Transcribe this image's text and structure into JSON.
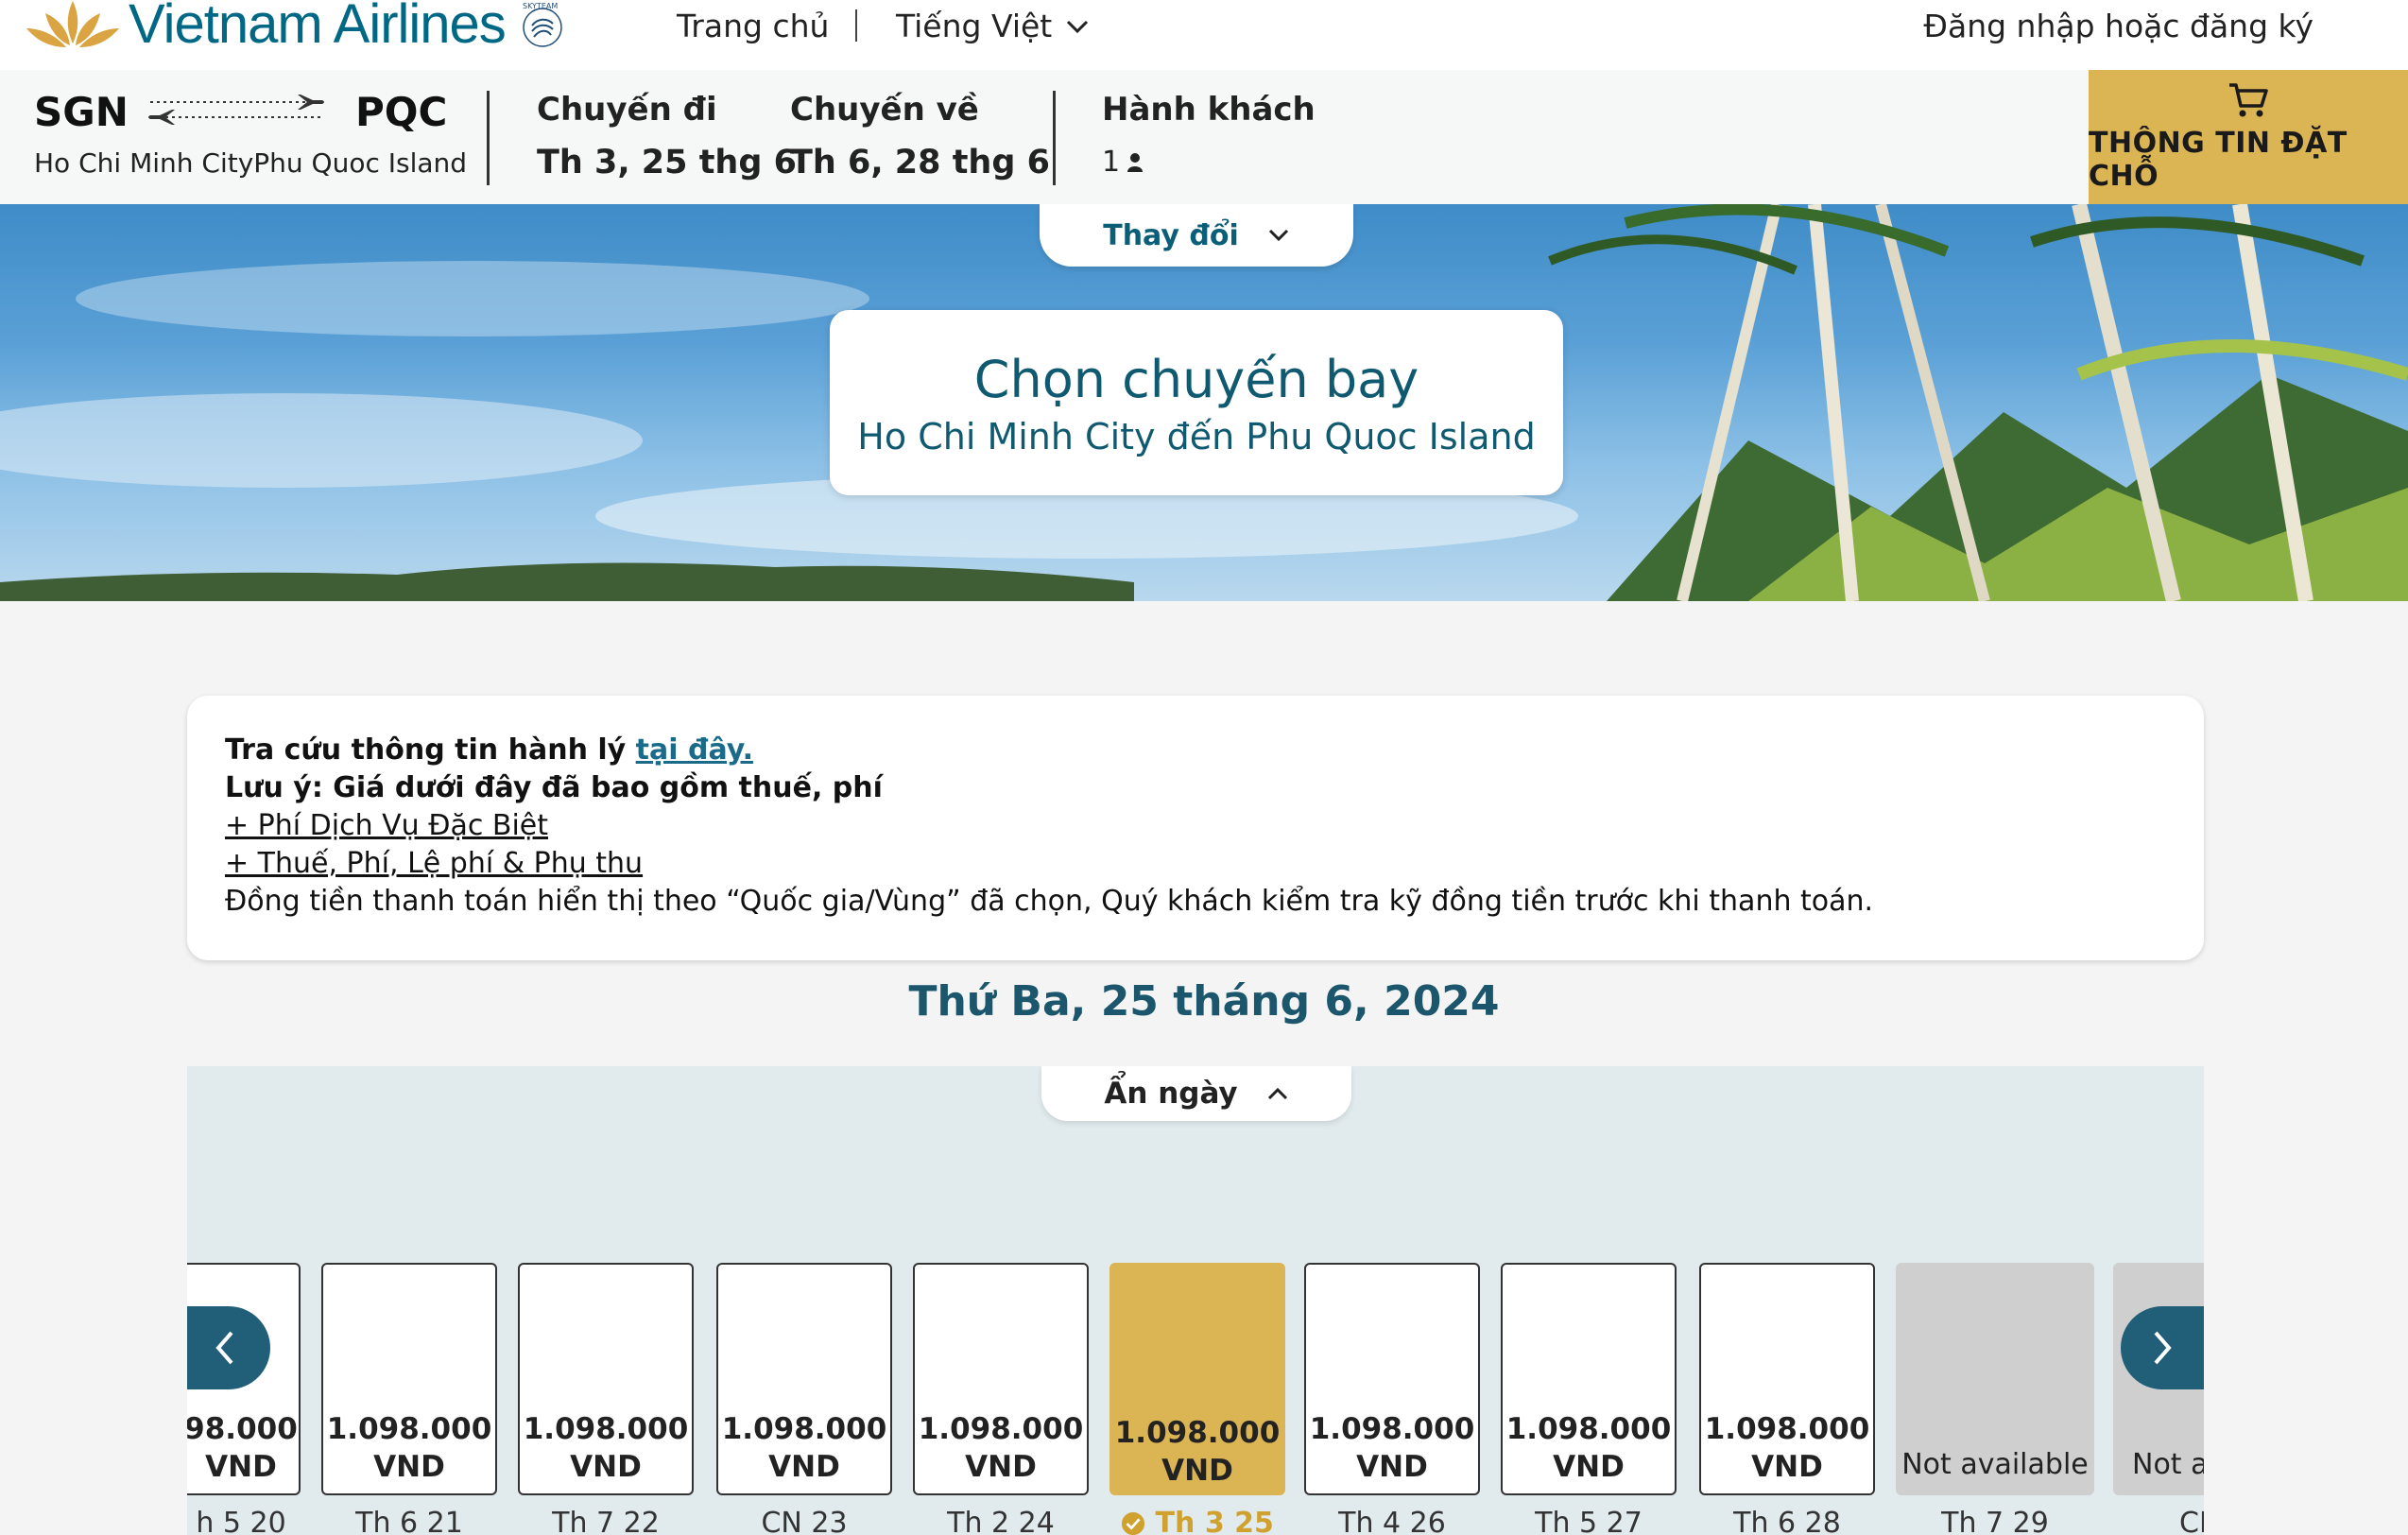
{
  "header": {
    "brand": "Vietnam Airlines",
    "nav_home": "Trang chủ",
    "nav_language": "Tiếng Việt",
    "login": "Đăng nhập hoặc đăng ký"
  },
  "itinerary": {
    "origin_code": "SGN",
    "destination_code": "PQC",
    "cities": "Ho Chi Minh CityPhu Quoc Island",
    "outbound_label": "Chuyến đi",
    "outbound_date": "Th 3, 25 thg 6",
    "return_label": "Chuyến về",
    "return_date": "Th 6, 28 thg 6",
    "passengers_label": "Hành khách",
    "passengers_count": "1",
    "booking_button": "THÔNG TIN ĐẶT CHỖ"
  },
  "hero": {
    "change_tab": "Thay đổi",
    "title": "Chọn chuyến bay",
    "subtitle": "Ho Chi Minh City đến Phu Quoc Island"
  },
  "info": {
    "baggage_text": "Tra cứu thông tin hành lý ",
    "baggage_link": "tại đây.",
    "note": "Lưu ý: Giá dưới đây đã bao gồm thuế, phí",
    "special_fees_link": "+ Phí Dịch Vụ Đặc Biệt",
    "taxes_link": "+ Thuế, Phí, Lệ phí & Phụ thu",
    "currency_note": "Đồng tiền thanh toán hiển thị theo “Quốc gia/Vùng” đã chọn, Quý khách kiểm tra kỹ đồng tiền trước khi thanh toán."
  },
  "date_heading": "Thứ Ba, 25 tháng 6, 2024",
  "date_strip": {
    "hide_tab": "Ẩn ngày",
    "days": [
      {
        "price": "98.000",
        "currency": "VND",
        "label": "h 5 20",
        "status": "partial"
      },
      {
        "price": "1.098.000",
        "currency": "VND",
        "label": "Th 6 21",
        "status": "available"
      },
      {
        "price": "1.098.000",
        "currency": "VND",
        "label": "Th 7 22",
        "status": "available"
      },
      {
        "price": "1.098.000",
        "currency": "VND",
        "label": "CN 23",
        "status": "available"
      },
      {
        "price": "1.098.000",
        "currency": "VND",
        "label": "Th 2 24",
        "status": "available"
      },
      {
        "price": "1.098.000",
        "currency": "VND",
        "label": "Th 3 25",
        "status": "selected"
      },
      {
        "price": "1.098.000",
        "currency": "VND",
        "label": "Th 4 26",
        "status": "available"
      },
      {
        "price": "1.098.000",
        "currency": "VND",
        "label": "Th 5 27",
        "status": "available"
      },
      {
        "price": "1.098.000",
        "currency": "VND",
        "label": "Th 6 28",
        "status": "available"
      },
      {
        "na_text": "Not available",
        "label": "Th 7 29",
        "status": "unavailable"
      },
      {
        "na_text": "Not av",
        "label": "CN",
        "status": "unavailable"
      }
    ]
  },
  "colors": {
    "brand_teal": "#006885",
    "gold": "#dbb454",
    "heading_teal": "#1b566c",
    "arrow_blue": "#215e78"
  },
  "icons": [
    "lotus-logo",
    "skyteam-logo",
    "chevron-down-icon",
    "plane-icon",
    "person-icon",
    "cart-icon",
    "chevron-up-icon",
    "chevron-left-icon",
    "chevron-right-icon",
    "check-circle-icon"
  ]
}
